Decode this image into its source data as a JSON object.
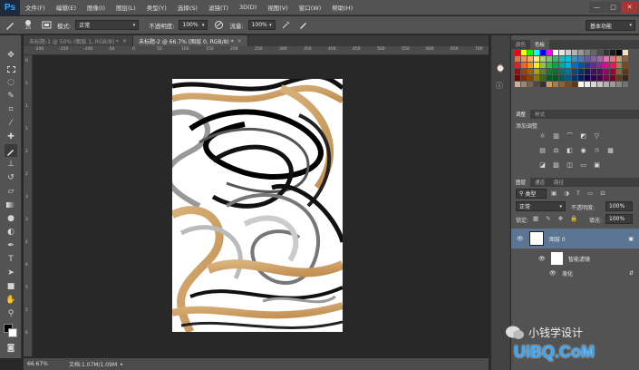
{
  "app": {
    "logo": "Ps"
  },
  "menu": {
    "items": [
      "文件(F)",
      "编辑(E)",
      "图像(I)",
      "图层(L)",
      "类型(Y)",
      "选择(S)",
      "滤镜(T)",
      "3D(D)",
      "视图(V)",
      "窗口(W)",
      "帮助(H)"
    ]
  },
  "window_controls": {
    "minimize": "—",
    "maximize": "□",
    "close": "✕"
  },
  "options": {
    "brush_size": "25",
    "mode_label": "模式:",
    "mode_value": "正常",
    "opacity_label": "不透明度:",
    "opacity_value": "100%",
    "flow_label": "流量:",
    "flow_value": "100%",
    "workspace": "基本功能"
  },
  "tabs": [
    {
      "label": "未标题-1 @ 50% (图层 1, RGB/8) *",
      "close": "×"
    },
    {
      "label": "未标题-2 @ 66.7% (图层 0, RGB/8) *",
      "close": "×"
    }
  ],
  "ruler": {
    "h_ticks": [
      "-200",
      "-150",
      "-100",
      "-50",
      "0",
      "50",
      "100",
      "150",
      "200",
      "250",
      "300",
      "350",
      "400",
      "450",
      "500",
      "550",
      "600",
      "650",
      "700"
    ],
    "v_ticks": [
      "0",
      "5",
      "1",
      "1",
      "2",
      "2",
      "3",
      "3",
      "4",
      "4",
      "5",
      "5",
      "6"
    ]
  },
  "status": {
    "zoom": "66.67%",
    "doc_info": "文档:1.07M/1.09M"
  },
  "panels": {
    "color_tabs": [
      "颜色",
      "色板"
    ],
    "adjust_tabs": [
      "调整",
      "样式"
    ],
    "adjust_title": "添加调整",
    "layers_tabs": [
      "图层",
      "通道",
      "路径"
    ],
    "kind_label": "类型",
    "blend_mode": "正常",
    "opacity_label": "不透明度:",
    "opacity_value": "100%",
    "lock_label": "锁定:",
    "fill_label": "填充:",
    "fill_value": "100%",
    "layers": [
      {
        "name": "图层 0"
      },
      {
        "name": "智能滤镜"
      },
      {
        "name": "液化"
      }
    ]
  },
  "watermark": {
    "text": "小钱学设计",
    "site": "UiBQ.CoM"
  },
  "colors": {
    "chrome": "#535353",
    "dark": "#282828",
    "selected_layer": "#5b7593",
    "accent_blue": "#31a8ff"
  }
}
